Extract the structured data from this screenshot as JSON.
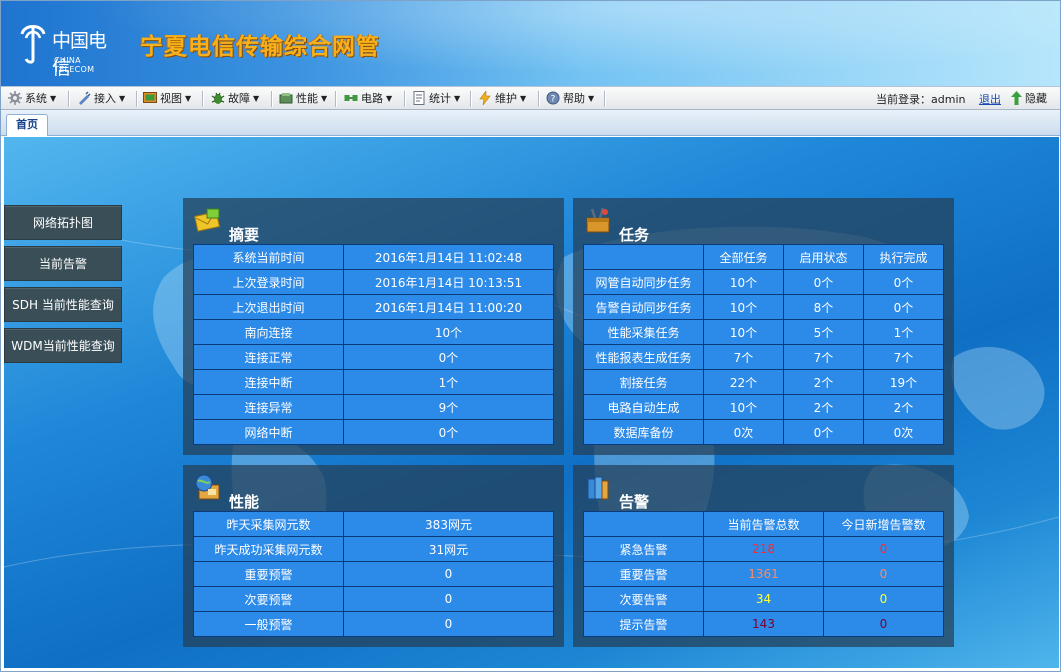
{
  "header": {
    "logo_cn": "中国电信",
    "logo_en": "CHINA TELECOM",
    "system_title": "宁夏电信传输综合网管"
  },
  "toolbar": {
    "menus": [
      {
        "label": "系统",
        "icon": "gear-icon"
      },
      {
        "label": "接入",
        "icon": "plug-icon"
      },
      {
        "label": "视图",
        "icon": "monitor-icon"
      },
      {
        "label": "故障",
        "icon": "bug-icon"
      },
      {
        "label": "性能",
        "icon": "chart-icon"
      },
      {
        "label": "电路",
        "icon": "circuit-icon"
      },
      {
        "label": "统计",
        "icon": "report-icon"
      },
      {
        "label": "维护",
        "icon": "lightning-icon"
      },
      {
        "label": "帮助",
        "icon": "help-icon"
      }
    ],
    "login_label": "当前登录：admin",
    "logout_label": "退出",
    "hide_label": "隐藏"
  },
  "tabs": [
    {
      "label": "首页"
    }
  ],
  "sidebar": {
    "items": [
      {
        "label": "网络拓扑图"
      },
      {
        "label": "当前告警"
      },
      {
        "label": "SDH 当前性能查询"
      },
      {
        "label": "WDM当前性能查询"
      }
    ]
  },
  "summary": {
    "title": "摘要",
    "rows": [
      {
        "label": "系统当前时间",
        "value": "2016年1月14日 11:02:48"
      },
      {
        "label": "上次登录时间",
        "value": "2016年1月14日 10:13:51"
      },
      {
        "label": "上次退出时间",
        "value": "2016年1月14日 11:00:20"
      },
      {
        "label": "南向连接",
        "value": "10个"
      },
      {
        "label": "连接正常",
        "value": "0个"
      },
      {
        "label": "连接中断",
        "value": "1个"
      },
      {
        "label": "连接异常",
        "value": "9个"
      },
      {
        "label": "网络中断",
        "value": "0个"
      }
    ]
  },
  "tasks": {
    "title": "任务",
    "headers": [
      "全部任务",
      "启用状态",
      "执行完成"
    ],
    "rows": [
      {
        "label": "网管自动同步任务",
        "values": [
          "10个",
          "0个",
          "0个"
        ]
      },
      {
        "label": "告警自动同步任务",
        "values": [
          "10个",
          "8个",
          "0个"
        ]
      },
      {
        "label": "性能采集任务",
        "values": [
          "10个",
          "5个",
          "1个"
        ]
      },
      {
        "label": "性能报表生成任务",
        "values": [
          "7个",
          "7个",
          "7个"
        ]
      },
      {
        "label": "割接任务",
        "values": [
          "22个",
          "2个",
          "19个"
        ]
      },
      {
        "label": "电路自动生成",
        "values": [
          "10个",
          "2个",
          "2个"
        ]
      },
      {
        "label": "数据库备份",
        "values": [
          "0次",
          "0个",
          "0次"
        ]
      }
    ]
  },
  "performance": {
    "title": "性能",
    "rows": [
      {
        "label": "昨天采集网元数",
        "value": "383网元"
      },
      {
        "label": "昨天成功采集网元数",
        "value": "31网元"
      },
      {
        "label": "重要预警",
        "value": "0"
      },
      {
        "label": "次要预警",
        "value": "0"
      },
      {
        "label": "一般预警",
        "value": "0"
      }
    ]
  },
  "alarms": {
    "title": "告警",
    "headers": [
      "当前告警总数",
      "今日新增告警数"
    ],
    "rows": [
      {
        "label": "紧急告警",
        "values": [
          "218",
          "0"
        ],
        "color": "#ff2a2a"
      },
      {
        "label": "重要告警",
        "values": [
          "1361",
          "0"
        ],
        "color": "#ff8a5a"
      },
      {
        "label": "次要告警",
        "values": [
          "34",
          "0"
        ],
        "color": "#ffff3a"
      },
      {
        "label": "提示告警",
        "values": [
          "143",
          "0"
        ],
        "color": "#7a0030"
      }
    ]
  }
}
